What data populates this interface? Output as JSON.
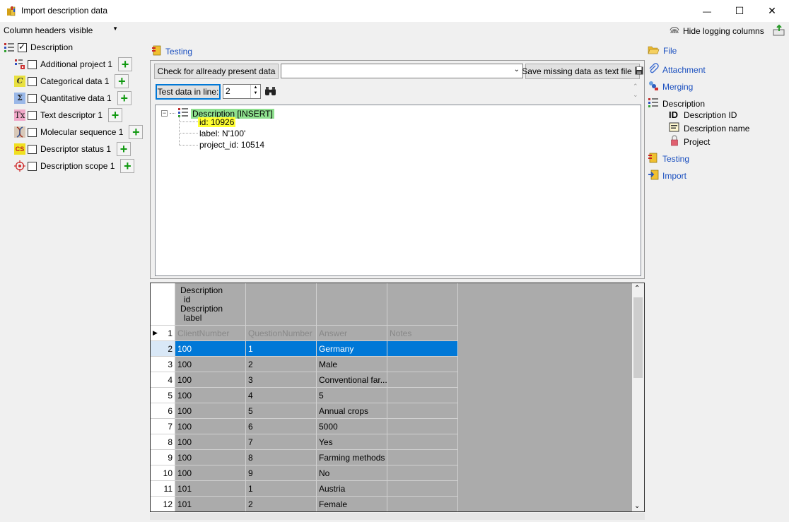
{
  "window": {
    "title": "Import description data",
    "minimize_glyph": "—",
    "maximize_glyph": "☐",
    "close_glyph": "✕"
  },
  "toolbar": {
    "column_headers_label": "Column headers",
    "column_headers_value": "visible",
    "hide_logging_label": "Hide logging columns"
  },
  "left_tree": {
    "root": {
      "label": "Description",
      "checked": true
    },
    "items": [
      {
        "label": "Additional project 1",
        "icon": "additional-project-icon"
      },
      {
        "label": "Categorical data 1",
        "icon": "categorical-data-icon"
      },
      {
        "label": "Quantitative data 1",
        "icon": "quantitative-data-icon"
      },
      {
        "label": "Text descriptor 1",
        "icon": "text-descriptor-icon"
      },
      {
        "label": "Molecular sequence 1",
        "icon": "molecular-sequence-icon"
      },
      {
        "label": "Descriptor status 1",
        "icon": "descriptor-status-icon"
      },
      {
        "label": "Description scope 1",
        "icon": "description-scope-icon"
      }
    ]
  },
  "center": {
    "section_title": "Testing",
    "check_button": "Check for allready present data",
    "combo_value": "",
    "save_button": "Save missing data as text file",
    "test_line_button": "Test data in line:",
    "test_line_value": "2",
    "tree": {
      "root": "Description [INSERT]",
      "children": [
        "id: 10926",
        "label: N'100'",
        "project_id: 10514"
      ]
    }
  },
  "grid": {
    "header_block": [
      "Description",
      "id",
      "Description",
      "label"
    ],
    "columns": [
      "ClientNumber",
      "QuestionNumber",
      "Answer",
      "Notes"
    ],
    "first_row_num": "1",
    "rows": [
      {
        "n": "2",
        "c": [
          "100",
          "1",
          "Germany",
          ""
        ]
      },
      {
        "n": "3",
        "c": [
          "100",
          "2",
          "Male",
          ""
        ]
      },
      {
        "n": "4",
        "c": [
          "100",
          "3",
          "Conventional far...",
          ""
        ]
      },
      {
        "n": "5",
        "c": [
          "100",
          "4",
          "5",
          ""
        ]
      },
      {
        "n": "6",
        "c": [
          "100",
          "5",
          "Annual crops",
          ""
        ]
      },
      {
        "n": "7",
        "c": [
          "100",
          "6",
          "5000",
          ""
        ]
      },
      {
        "n": "8",
        "c": [
          "100",
          "7",
          "Yes",
          ""
        ]
      },
      {
        "n": "9",
        "c": [
          "100",
          "8",
          "Farming methods ...",
          ""
        ]
      },
      {
        "n": "10",
        "c": [
          "100",
          "9",
          "No",
          ""
        ]
      },
      {
        "n": "11",
        "c": [
          "101",
          "1",
          "Austria",
          ""
        ]
      },
      {
        "n": "12",
        "c": [
          "101",
          "2",
          "Female",
          ""
        ]
      }
    ]
  },
  "right_panel": {
    "file": "File",
    "attachment": "Attachment",
    "merging": "Merging",
    "description": "Description",
    "description_id": "Description ID",
    "description_name": "Description name",
    "project": "Project",
    "testing": "Testing",
    "import": "Import"
  },
  "colors": {
    "accent": "#0078d7",
    "link": "#1a4fbf",
    "insert_highlight": "#8ee08e",
    "id_highlight": "#ffff33",
    "add_green": "#119911"
  }
}
